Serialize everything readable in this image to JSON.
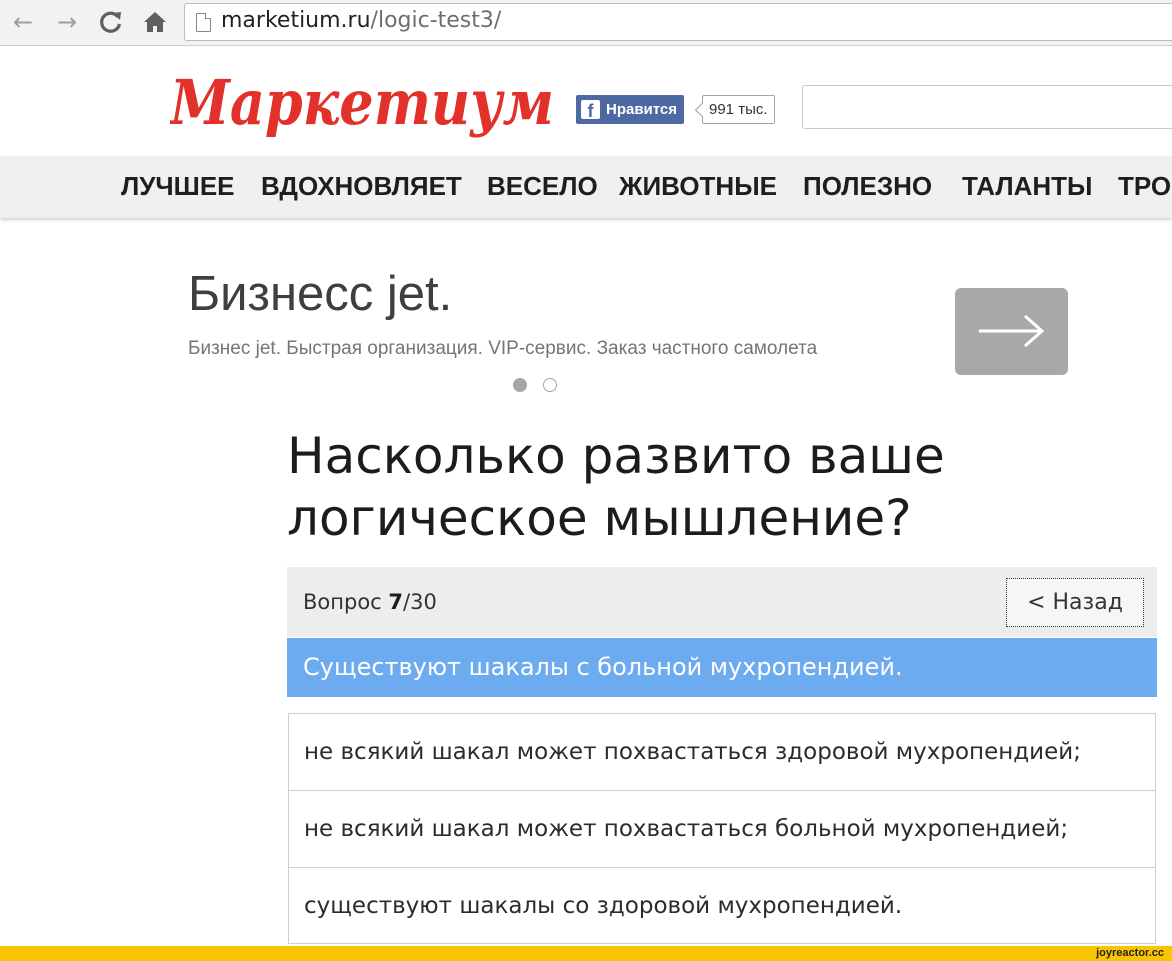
{
  "browser": {
    "url_domain": "marketium.ru",
    "url_path": "/logic-test3/",
    "icons": [
      "back-arrow-icon",
      "forward-arrow-icon",
      "reload-icon",
      "home-icon",
      "page-icon"
    ]
  },
  "header": {
    "logo_text": "Маркетиум",
    "logo_color": "#e2302b",
    "fb_like_label": "Нравится",
    "fb_like_count": "991 тыс.",
    "search_placeholder": ""
  },
  "nav": {
    "items": [
      "ЛУЧШЕЕ",
      "ВДОХНОВЛЯЕТ",
      "ВЕСЕЛО",
      "ЖИВОТНЫЕ",
      "ПОЛЕЗНО",
      "ТАЛАНТЫ",
      "ТРО"
    ]
  },
  "ad": {
    "title": "Бизнесс jet.",
    "subtitle": "Бизнес jet. Быстрая организация. VIP-сервис. Заказ частного самолета",
    "slide_active": 1,
    "slide_count": 2
  },
  "quiz": {
    "title": "Насколько развито ваше логическое мышление?",
    "counter_label": "Вопрос",
    "counter_current": "7",
    "counter_total": "/30",
    "back_label": "< Назад",
    "question": "Существуют шакалы с больной мухропендией.",
    "question_bg": "#6cabef",
    "answers": [
      "не всякий шакал может похвастаться здоровой мухропендией;",
      "не всякий шакал может похвастаться больной мухропендией;",
      "существуют шакалы со здоровой мухропендией."
    ]
  },
  "watermark": {
    "text": "joyreactor.cc",
    "bar_color": "#f9c500"
  }
}
